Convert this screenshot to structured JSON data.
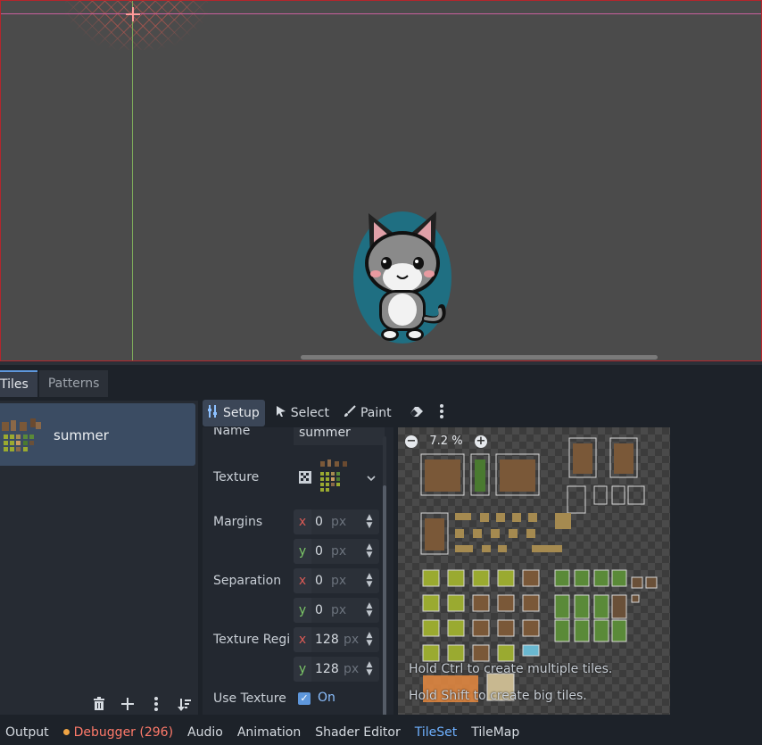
{
  "panel_tabs": [
    {
      "label": "Tiles",
      "active": true
    },
    {
      "label": "Patterns",
      "active": false
    }
  ],
  "sources": {
    "items": [
      {
        "label": "summer"
      }
    ]
  },
  "atlas_toolbar": {
    "setup_label": "Setup",
    "select_label": "Select",
    "paint_label": "Paint"
  },
  "inspector": {
    "name_label": "Name",
    "name_value": "summer",
    "texture_label": "Texture",
    "margins_label": "Margins",
    "margins": {
      "x": "0",
      "y": "0",
      "unit": "px"
    },
    "separation_label": "Separation",
    "separation": {
      "x": "0",
      "y": "0",
      "unit": "px"
    },
    "texture_region_label": "Texture Regi",
    "texture_region": {
      "x": "128",
      "y": "128",
      "unit": "px"
    },
    "use_texture_label": "Use Texture",
    "use_texture_value": "On",
    "axis_x": "x",
    "axis_y": "y"
  },
  "atlas": {
    "zoom": "7.2 %",
    "hint_ctrl": "Hold Ctrl to create multiple tiles.",
    "hint_shift": "Hold Shift to create big tiles."
  },
  "bottom_bar": {
    "output": "Output",
    "debugger": "Debugger (296)",
    "audio": "Audio",
    "animation": "Animation",
    "shader_editor": "Shader Editor",
    "tileset": "TileSet",
    "tilemap": "TileMap"
  },
  "colors": {
    "accent": "#5e97dc",
    "axis_x": "#d95a55",
    "axis_y": "#7bc567",
    "debugger_warn": "#ff7a6a"
  },
  "icons": {
    "setup": "wrench-icon",
    "select": "cursor-icon",
    "paint": "brush-icon",
    "erase": "eraser-icon",
    "more": "kebab-menu-icon",
    "delete": "trash-icon",
    "add": "plus-icon",
    "sort": "sort-icon",
    "texture": "texture-icon",
    "zoom_out": "zoom-out-icon",
    "zoom_in": "zoom-in-icon"
  }
}
